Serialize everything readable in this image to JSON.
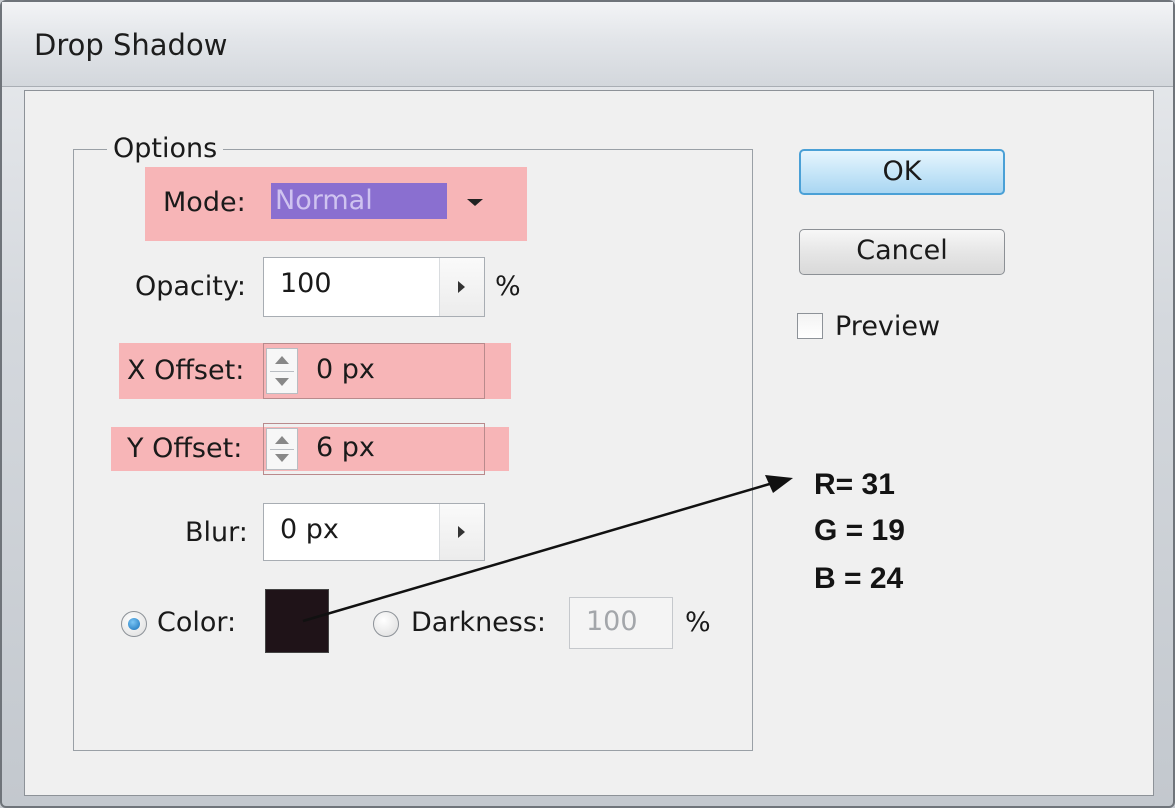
{
  "window": {
    "title": "Drop Shadow"
  },
  "options": {
    "legend": "Options",
    "mode": {
      "label": "Mode:",
      "value": "Normal"
    },
    "opacity": {
      "label": "Opacity:",
      "value": "100",
      "unit": "%"
    },
    "x_offset": {
      "label": "X Offset:",
      "value": "0 px"
    },
    "y_offset": {
      "label": "Y Offset:",
      "value": "6 px"
    },
    "blur": {
      "label": "Blur:",
      "value": "0 px"
    },
    "color": {
      "label": "Color:",
      "selected": true,
      "swatch": "#1f1318"
    },
    "darkness": {
      "label": "Darkness:",
      "value": "100",
      "unit": "%",
      "selected": false
    }
  },
  "buttons": {
    "ok": "OK",
    "cancel": "Cancel"
  },
  "preview": {
    "label": "Preview",
    "checked": false
  },
  "annotation": {
    "r": "R= 31",
    "g": "G = 19",
    "b": "B = 24"
  },
  "colors": {
    "highlight": "#f7b0b2",
    "ok_border": "#4aa0d6",
    "select_fill": "#8a6fd0"
  }
}
